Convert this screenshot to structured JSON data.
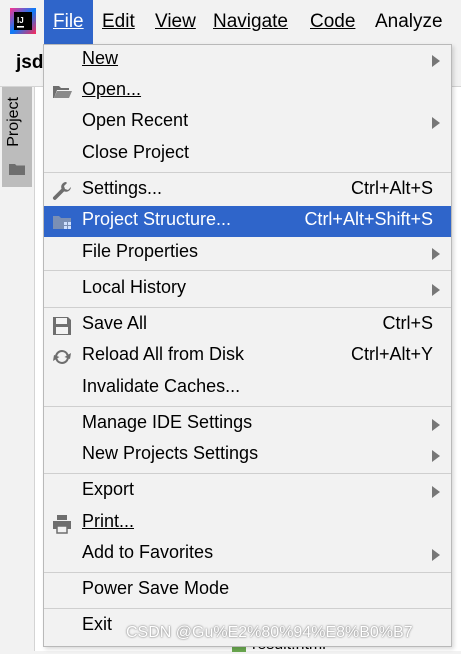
{
  "menubar": {
    "items": [
      "File",
      "Edit",
      "View",
      "Navigate",
      "Code",
      "Analyze"
    ]
  },
  "toolbar": {
    "project_name": "jsd"
  },
  "tool_stripe": {
    "project_tab": "Project"
  },
  "file_menu": {
    "new": "New",
    "open": "Open...",
    "open_recent": "Open Recent",
    "close_project": "Close Project",
    "settings": "Settings...",
    "settings_shortcut": "Ctrl+Alt+S",
    "project_structure": "Project Structure...",
    "project_structure_shortcut": "Ctrl+Alt+Shift+S",
    "file_properties": "File Properties",
    "local_history": "Local History",
    "save_all": "Save All",
    "save_all_shortcut": "Ctrl+S",
    "reload_all": "Reload All from Disk",
    "reload_all_shortcut": "Ctrl+Alt+Y",
    "invalidate_caches": "Invalidate Caches...",
    "manage_ide_settings": "Manage IDE Settings",
    "new_projects_settings": "New Projects Settings",
    "export": "Export",
    "print": "Print...",
    "add_to_favorites": "Add to Favorites",
    "power_save_mode": "Power Save Mode",
    "exit": "Exit"
  },
  "editor": {
    "bottom_file": "result.html"
  },
  "watermark": "CSDN @Gu%E2%80%94%E8%B0%B7",
  "colors": {
    "accent": "#2f65ca",
    "menu_bg": "#f2f2f2"
  }
}
